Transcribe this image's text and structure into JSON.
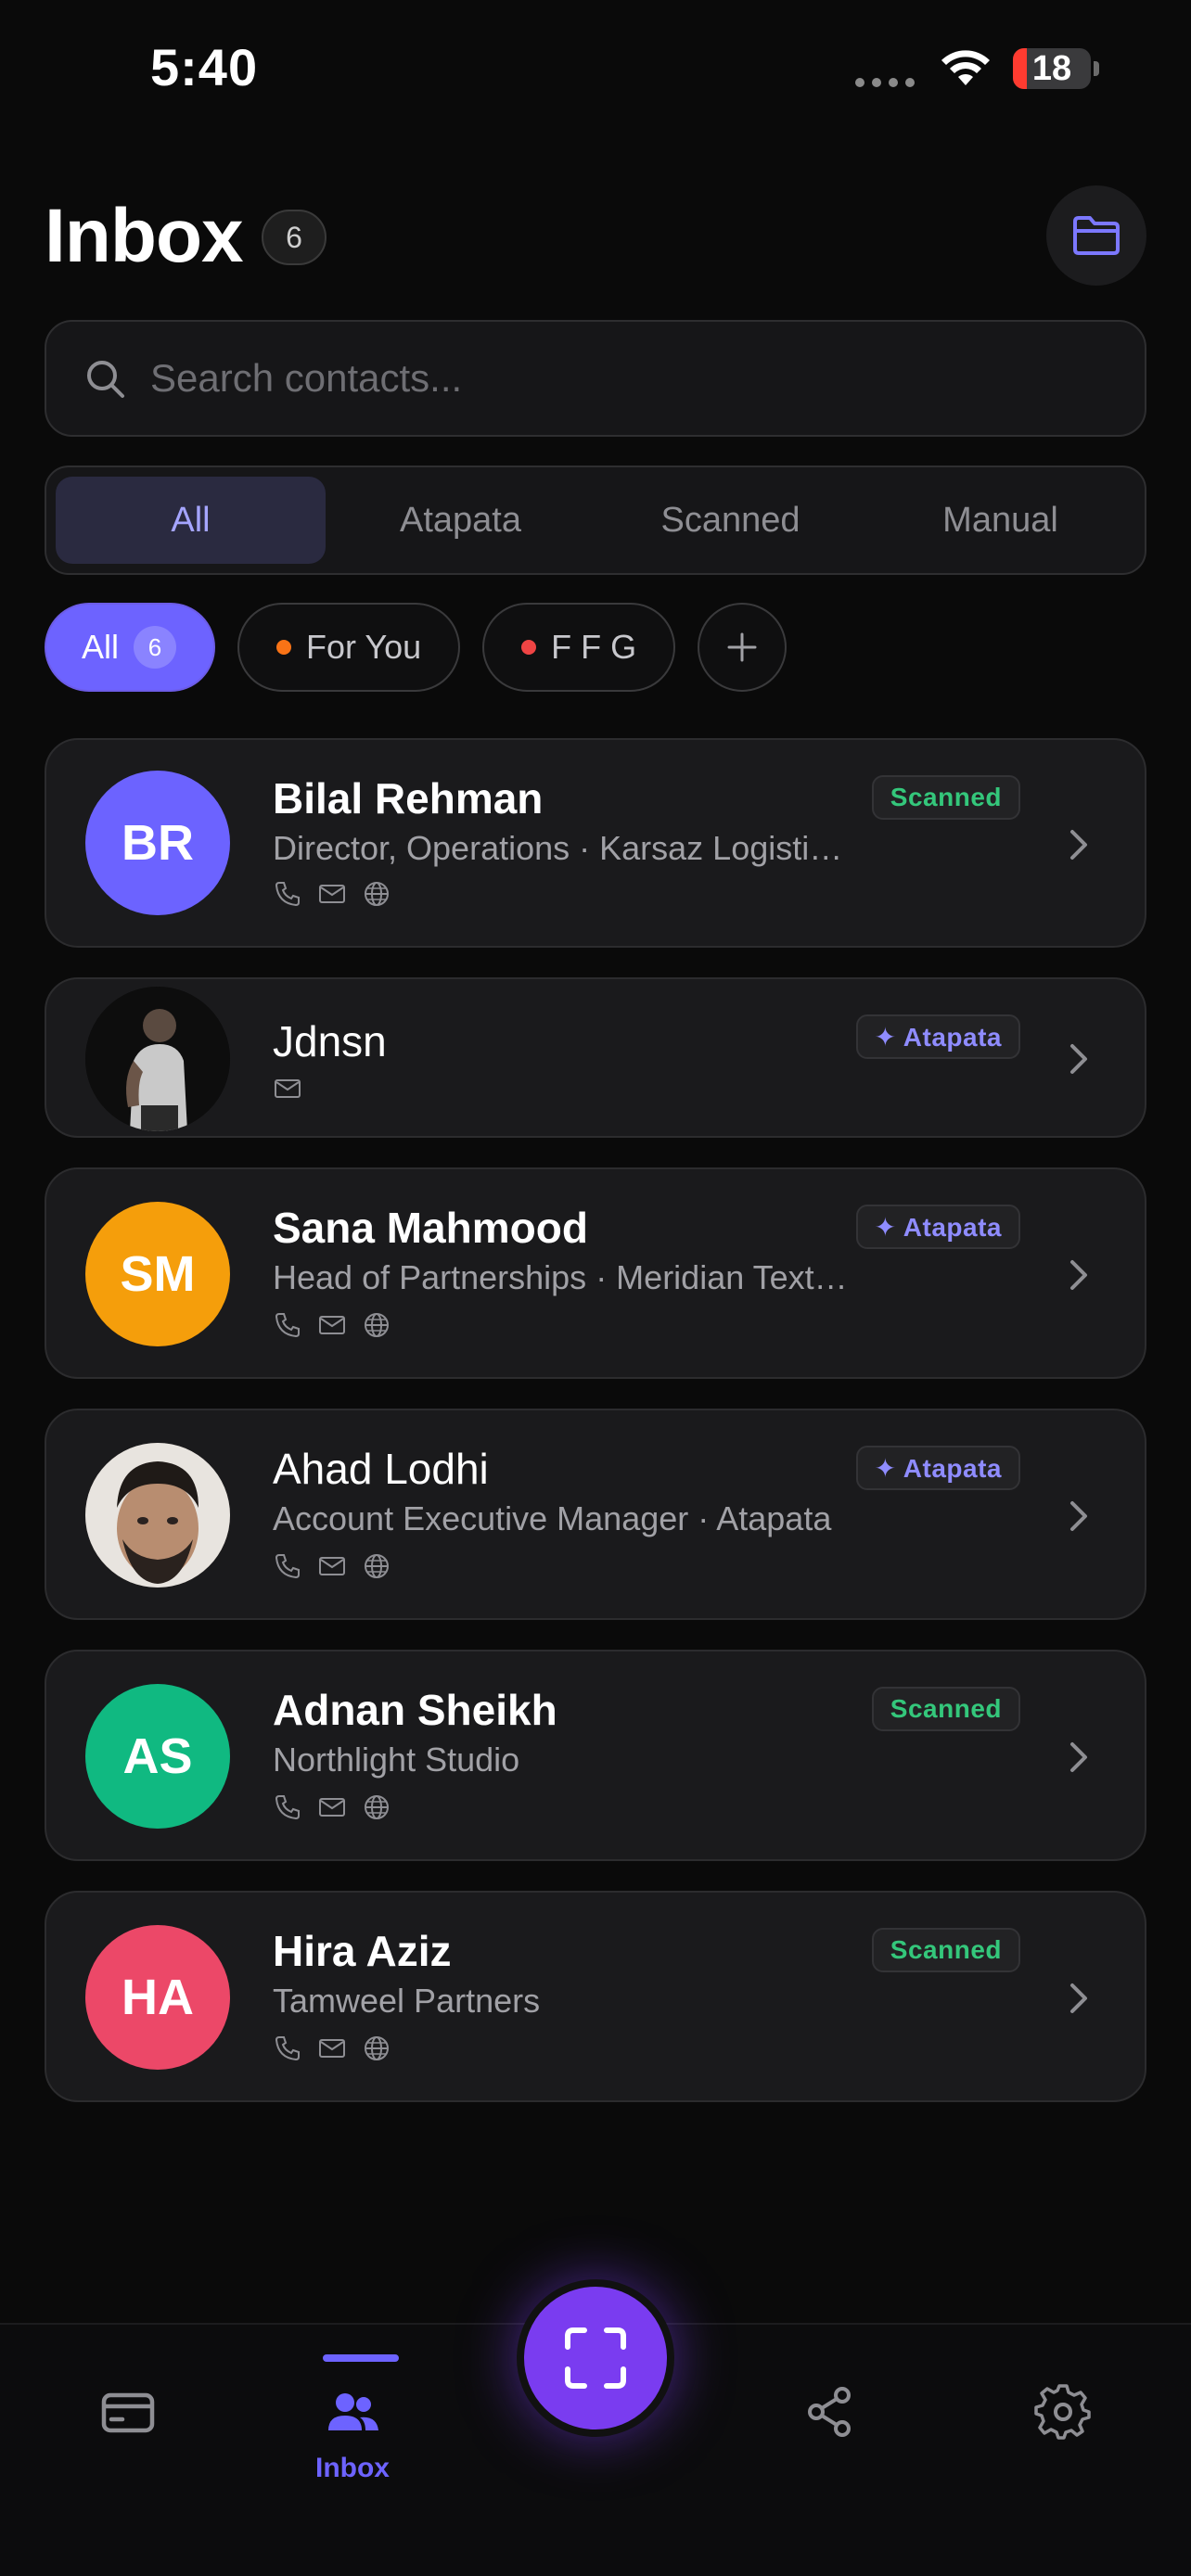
{
  "status_bar": {
    "time": "5:40",
    "battery": "18",
    "battery_level": 0.18
  },
  "header": {
    "title": "Inbox",
    "count": "6"
  },
  "search": {
    "placeholder": "Search contacts..."
  },
  "segments": [
    {
      "label": "All",
      "active": true
    },
    {
      "label": "Atapata",
      "active": false
    },
    {
      "label": "Scanned",
      "active": false
    },
    {
      "label": "Manual",
      "active": false
    }
  ],
  "chips": {
    "all": {
      "label": "All",
      "count": "6"
    },
    "for_you": {
      "label": "For You",
      "dot_color": "#f97316"
    },
    "ffg": {
      "label": "F F G",
      "dot_color": "#ef4444"
    },
    "add": "+"
  },
  "contacts": [
    {
      "initials": "BR",
      "name": "Bilal Rehman",
      "subtitle": "Director, Operations · Karsaz Logisti…",
      "badge": "Scanned",
      "avatar_color": "#6c63ff",
      "icons": [
        "phone-icon",
        "mail-icon",
        "globe-icon"
      ]
    },
    {
      "initials": "",
      "name": "Jdnsn",
      "subtitle": "",
      "badge": "✦ Atapata",
      "avatar_color": "#111111",
      "icons": [
        "mail-icon"
      ]
    },
    {
      "initials": "SM",
      "name": "Sana Mahmood",
      "subtitle": "Head of Partnerships · Meridian Text…",
      "badge": "✦ Atapata",
      "avatar_color": "#f59e0b",
      "icons": [
        "phone-icon",
        "mail-icon",
        "globe-icon"
      ]
    },
    {
      "initials": "",
      "name": "Ahad Lodhi",
      "subtitle": "Account Executive Manager · Atapata",
      "badge": "✦ Atapata",
      "avatar_color": "#5a4e46",
      "icons": [
        "phone-icon",
        "mail-icon",
        "globe-icon"
      ]
    },
    {
      "initials": "AS",
      "name": "Adnan Sheikh",
      "subtitle": "Northlight Studio",
      "badge": "Scanned",
      "avatar_color": "#10b981",
      "icons": [
        "phone-icon",
        "mail-icon",
        "globe-icon"
      ]
    },
    {
      "initials": "HA",
      "name": "Hira Aziz",
      "subtitle": "Tamweel Partners",
      "badge": "Scanned",
      "avatar_color": "#ec4868",
      "icons": [
        "phone-icon",
        "mail-icon",
        "globe-icon"
      ]
    }
  ],
  "bottom_nav": {
    "items": [
      {
        "icon": "card-icon",
        "label": ""
      },
      {
        "icon": "users-icon",
        "label": "Inbox",
        "active": true
      },
      {
        "icon": "share-icon",
        "label": ""
      },
      {
        "icon": "gear-icon",
        "label": ""
      }
    ],
    "fab_icon": "scan-icon"
  },
  "colors": {
    "accent": "#6d63ff",
    "fab": "#7a3cf0",
    "scanned": "#34c77b",
    "atapata": "#8f8cff"
  }
}
